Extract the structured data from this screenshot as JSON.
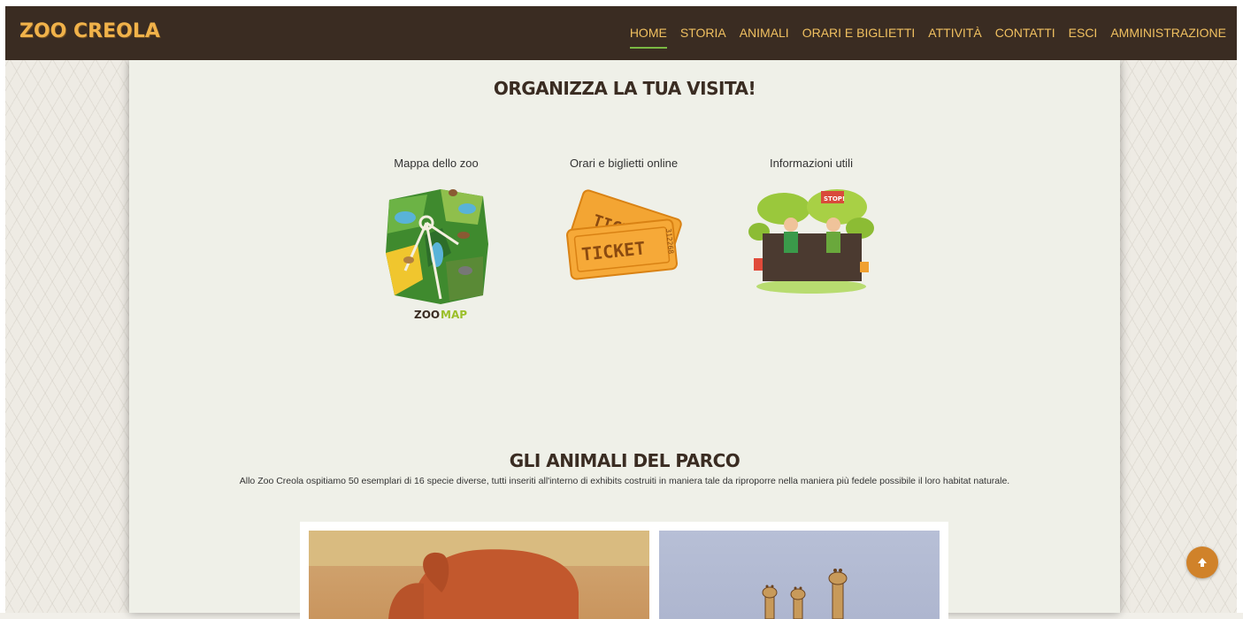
{
  "brand": "ZOO CREOLA",
  "nav": {
    "items": [
      {
        "label": "HOME",
        "active": true
      },
      {
        "label": "STORIA"
      },
      {
        "label": "ANIMALI"
      },
      {
        "label": "ORARI E BIGLIETTI"
      },
      {
        "label": "ATTIVITÀ"
      },
      {
        "label": "CONTATTI"
      },
      {
        "label": "ESCI"
      },
      {
        "label": "AMMINISTRAZIONE"
      }
    ]
  },
  "visit": {
    "title": "ORGANIZZA LA TUA VISITA!",
    "tiles": [
      {
        "label": "Mappa dello zoo",
        "icon": "zoo-map-icon",
        "caption_a": "ZOO",
        "caption_b": "MAP"
      },
      {
        "label": "Orari e biglietti online",
        "icon": "ticket-icon",
        "ticket_text": "TICKET",
        "ticket_number": "312268"
      },
      {
        "label": "Informazioni utili",
        "icon": "info-keepers-icon",
        "sign_text": "STOP!"
      }
    ]
  },
  "animals": {
    "title": "GLI ANIMALI DEL PARCO",
    "intro": "Allo Zoo Creola ospitiamo 50 esemplari di 16 specie diverse, tutti inseriti all'interno di exhibits costruiti in maniera tale da riproporre nella maniera più fedele possibile il loro habitat naturale.",
    "photos": [
      {
        "subject": "elephant-photo"
      },
      {
        "subject": "giraffes-photo"
      }
    ]
  },
  "colors": {
    "nav_bg": "#3a2c22",
    "nav_text": "#f0c060",
    "brand": "#f0b24a",
    "active_underline": "#7ab843",
    "scroll_top": "#d0822a"
  },
  "scroll_top_icon": "arrow-up-icon"
}
